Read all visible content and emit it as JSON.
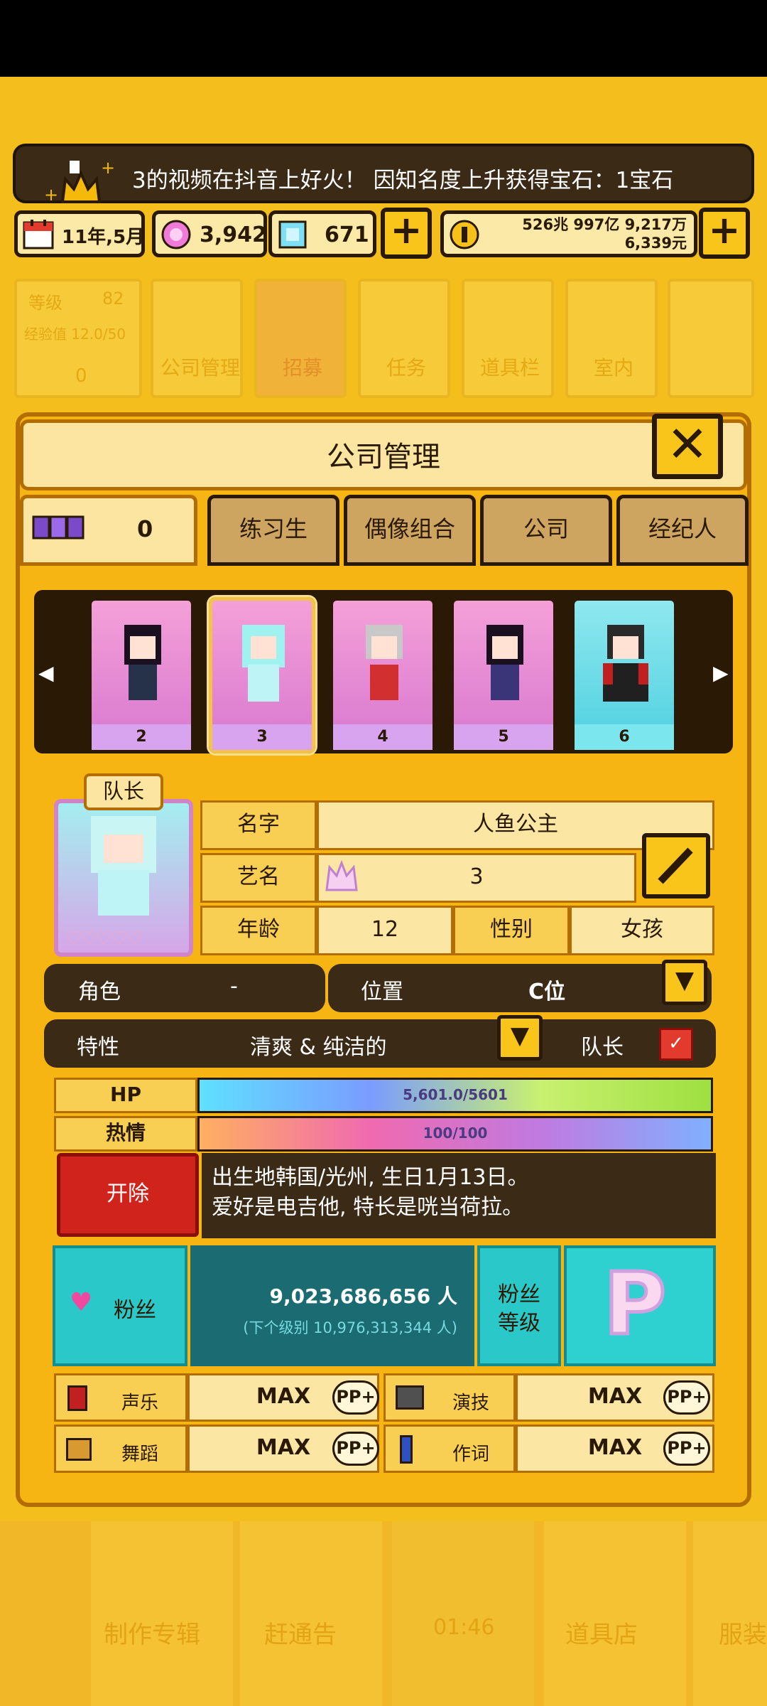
{
  "notification": {
    "text": "3的视频在抖音上好火！ 因知名度上升获得宝石：1宝石"
  },
  "status": {
    "date": "11年,5月",
    "gems_pink": "3,942",
    "gems_blue": "671",
    "money_line1": "526兆 997亿 9,217万",
    "money_line2": "6,339元"
  },
  "top_nav": {
    "level_label": "等级",
    "level_value": "82",
    "exp_label": "经验值 12.0/50",
    "exp_value": "0",
    "items": [
      "公司管理",
      "招募",
      "任务",
      "道具栏",
      "室内"
    ]
  },
  "panel": {
    "title": "公司管理",
    "group_count": "0",
    "tabs": [
      "练习生",
      "偶像组合",
      "公司",
      "经纪人"
    ]
  },
  "cards": [
    "2",
    "3",
    "4",
    "5",
    "6"
  ],
  "profile": {
    "leader_tag": "队长",
    "name_label": "名字",
    "name_value": "人鱼公主",
    "stage_label": "艺名",
    "stage_value": "3",
    "age_label": "年龄",
    "age_value": "12",
    "gender_label": "性别",
    "gender_value": "女孩",
    "role_label": "角色",
    "role_value": "-",
    "position_label": "位置",
    "position_value": "C位",
    "trait_label": "特性",
    "trait_value": "清爽 & 纯洁的",
    "leader_label": "队长"
  },
  "bars": {
    "hp_label": "HP",
    "hp_value": "5,601.0/5601",
    "hp_fraction": 1.0,
    "passion_label": "热情",
    "passion_value": "100/100",
    "passion_fraction": 1.0
  },
  "fire_button": "开除",
  "bio": {
    "line1": "出生地韩国/光州, 生日1月13日。",
    "line2": "爱好是电吉他, 特长是咣当荷拉。"
  },
  "fans": {
    "label": "粉丝",
    "count": "9,023,686,656 人",
    "next": "(下个级别 10,976,313,344 人)",
    "level_label_1": "粉丝",
    "level_label_2": "等级",
    "level_badge": "P"
  },
  "skills": [
    {
      "name": "声乐",
      "value": "MAX",
      "pp": "PP+"
    },
    {
      "name": "演技",
      "value": "MAX",
      "pp": "PP+"
    },
    {
      "name": "舞蹈",
      "value": "MAX",
      "pp": "PP+"
    },
    {
      "name": "作词",
      "value": "MAX",
      "pp": "PP+"
    }
  ],
  "bottom_nav": {
    "items": [
      "制作专辑",
      "赶通告",
      "01:46",
      "道具店",
      "服装"
    ]
  },
  "colors": {
    "background": "#f4bf1c",
    "panel": "#f6b512",
    "dark": "#3a2a16",
    "accent_red": "#d0231c",
    "teal": "#2ac8c8"
  }
}
